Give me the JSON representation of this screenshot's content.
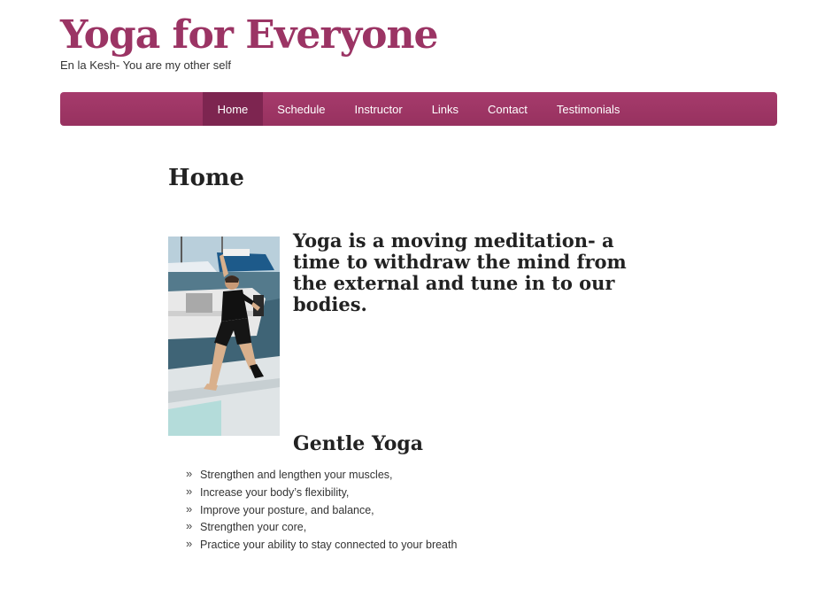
{
  "site": {
    "title": "Yoga for Everyone",
    "tagline": "En la Kesh- You are my other self",
    "brand_color": "#9b3464"
  },
  "nav": {
    "items": [
      {
        "label": "Home",
        "active": true
      },
      {
        "label": "Schedule"
      },
      {
        "label": "Instructor"
      },
      {
        "label": "Links"
      },
      {
        "label": "Contact"
      },
      {
        "label": "Testimonials"
      }
    ],
    "background": "#9b3464",
    "active_background": "#7d2550"
  },
  "main": {
    "page_title": "Home",
    "intro": "Yoga is a moving meditation- a time to withdraw the mind from the external and tune in to our bodies.",
    "subheading": "Gentle Yoga",
    "bullet_glyph": "»",
    "benefits": [
      "Strengthen and lengthen your muscles,",
      "Increase your body’s flexibility,",
      "Improve your posture, and balance,",
      "Strengthen your core,",
      "Practice your ability to stay connected to your breath"
    ]
  }
}
